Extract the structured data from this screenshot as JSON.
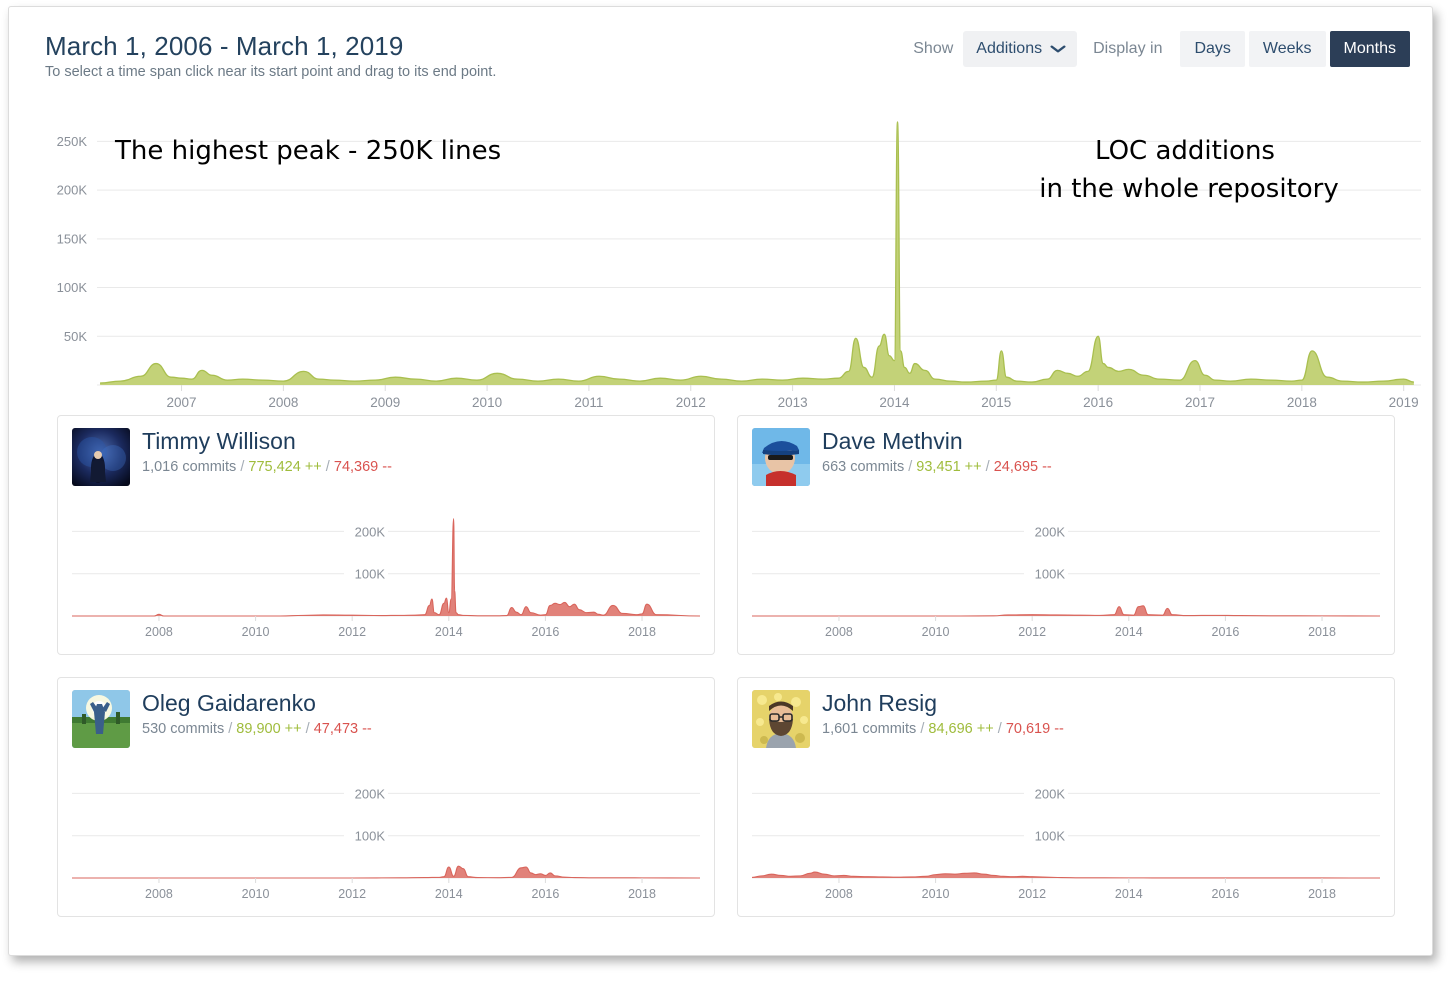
{
  "header": {
    "title": "March 1, 2006 - March 1, 2019",
    "subtitle": "To select a time span click near its start point and drag to its end point.",
    "show_label": "Show",
    "metric_selected": "Additions",
    "metric_options": [
      "Additions"
    ],
    "chevron": "⌄",
    "display_in_label": "Display in",
    "granularity": [
      {
        "label": "Days",
        "active": false
      },
      {
        "label": "Weeks",
        "active": false
      },
      {
        "label": "Months",
        "active": true
      }
    ]
  },
  "annotations": {
    "left": "The highest peak - 250K lines",
    "right_line1": "LOC additions",
    "right_line2": "in the whole repository"
  },
  "colors": {
    "main_fill": "#c3d278",
    "main_stroke": "#a9bf4f",
    "contrib_fill": "#e1827a",
    "contrib_stroke": "#d9655c",
    "accent_dark": "#2c3e57",
    "additions_green": "#9fbc3c",
    "deletions_red": "#d9534f",
    "grid": "#e9e9e9",
    "axis_text": "#8a9099"
  },
  "chart_data": {
    "type": "area",
    "title": "LOC additions in the whole repository",
    "xlabel": "",
    "ylabel": "",
    "ylim": [
      0,
      275000
    ],
    "yticks": [
      50000,
      100000,
      150000,
      200000,
      250000
    ],
    "ytick_labels": [
      "50K",
      "100K",
      "150K",
      "200K",
      "250K"
    ],
    "xticks": [
      2007,
      2008,
      2009,
      2010,
      2011,
      2012,
      2013,
      2014,
      2015,
      2016,
      2017,
      2018,
      2019
    ],
    "xtick_labels": [
      "2007",
      "2008",
      "2009",
      "2010",
      "2011",
      "2012",
      "2013",
      "2014",
      "2015",
      "2016",
      "2017",
      "2018",
      "2019"
    ],
    "xlim": [
      2006.17,
      2019.17
    ],
    "grid": true,
    "legend": "none",
    "series": [
      {
        "name": "Additions (months)",
        "x": [
          2006.2,
          2006.4,
          2006.6,
          2006.75,
          2006.9,
          2007.0,
          2007.1,
          2007.2,
          2007.3,
          2007.45,
          2007.6,
          2007.8,
          2008.0,
          2008.2,
          2008.35,
          2008.5,
          2008.7,
          2008.9,
          2009.1,
          2009.3,
          2009.5,
          2009.7,
          2009.9,
          2010.1,
          2010.3,
          2010.5,
          2010.7,
          2010.9,
          2011.1,
          2011.3,
          2011.5,
          2011.7,
          2011.9,
          2012.1,
          2012.3,
          2012.5,
          2012.7,
          2012.9,
          2013.1,
          2013.3,
          2013.45,
          2013.55,
          2013.62,
          2013.7,
          2013.78,
          2013.85,
          2013.9,
          2013.95,
          2014.0,
          2014.03,
          2014.06,
          2014.1,
          2014.15,
          2014.2,
          2014.3,
          2014.4,
          2014.55,
          2014.7,
          2014.9,
          2015.0,
          2015.05,
          2015.1,
          2015.2,
          2015.35,
          2015.5,
          2015.6,
          2015.7,
          2015.8,
          2015.9,
          2016.0,
          2016.05,
          2016.1,
          2016.2,
          2016.3,
          2016.45,
          2016.6,
          2016.8,
          2016.95,
          2017.05,
          2017.15,
          2017.3,
          2017.5,
          2017.7,
          2017.9,
          2018.0,
          2018.1,
          2018.25,
          2018.4,
          2018.6,
          2018.8,
          2019.0,
          2019.1
        ],
        "y": [
          2000,
          4000,
          9000,
          22000,
          8000,
          7000,
          6000,
          15000,
          10000,
          5000,
          6000,
          5000,
          4000,
          14000,
          6000,
          5000,
          4000,
          5000,
          8000,
          6000,
          4000,
          7000,
          5000,
          12000,
          6000,
          4000,
          6000,
          4000,
          9000,
          6000,
          4000,
          7000,
          5000,
          9000,
          6000,
          4000,
          6000,
          5000,
          7000,
          6000,
          7000,
          14000,
          48000,
          18000,
          8000,
          40000,
          52000,
          30000,
          25000,
          270000,
          35000,
          18000,
          12000,
          22000,
          15000,
          6000,
          4000,
          3000,
          4000,
          5000,
          35000,
          8000,
          4000,
          3000,
          6000,
          15000,
          12000,
          9000,
          14000,
          50000,
          22000,
          18000,
          14000,
          16000,
          10000,
          6000,
          5000,
          25000,
          10000,
          5000,
          4000,
          6000,
          5000,
          4000,
          5000,
          35000,
          8000,
          4000,
          3000,
          4000,
          6000,
          3000
        ]
      }
    ]
  },
  "contributors": [
    {
      "name": "Timmy Willison",
      "commits": "1,016 commits",
      "additions": "775,424 ++",
      "deletions": "74,369 --",
      "avatar": "avatar-timmy",
      "chart": {
        "type": "area",
        "ylim": [
          0,
          260000
        ],
        "yticks": [
          100000,
          200000
        ],
        "ytick_labels": [
          "100K",
          "200K"
        ],
        "xticks": [
          2008,
          2010,
          2012,
          2014,
          2016,
          2018
        ],
        "xtick_labels": [
          "2008",
          "2010",
          "2012",
          "2014",
          "2016",
          "2018"
        ],
        "xlim": [
          2006.2,
          2019.2
        ],
        "x": [
          2006.2,
          2007.5,
          2007.9,
          2008.0,
          2008.1,
          2009.0,
          2010.5,
          2011.0,
          2011.4,
          2012.0,
          2012.6,
          2013.0,
          2013.3,
          2013.5,
          2013.6,
          2013.65,
          2013.7,
          2013.8,
          2013.9,
          2013.95,
          2014.0,
          2014.05,
          2014.1,
          2014.12,
          2014.15,
          2014.2,
          2014.3,
          2014.6,
          2015.0,
          2015.2,
          2015.3,
          2015.4,
          2015.5,
          2015.6,
          2015.7,
          2015.9,
          2016.0,
          2016.1,
          2016.2,
          2016.3,
          2016.4,
          2016.5,
          2016.6,
          2016.7,
          2016.85,
          2017.0,
          2017.1,
          2017.2,
          2017.4,
          2017.6,
          2017.9,
          2018.0,
          2018.1,
          2018.3,
          2019.2
        ],
        "y": [
          0,
          0,
          0,
          4000,
          0,
          0,
          0,
          1500,
          2500,
          2000,
          1000,
          1500,
          2000,
          3000,
          25000,
          40000,
          8000,
          3000,
          30000,
          42000,
          8000,
          40000,
          230000,
          60000,
          8000,
          3000,
          1500,
          500,
          500,
          1000,
          20000,
          9000,
          3000,
          22000,
          8000,
          2000,
          3000,
          25000,
          30000,
          27000,
          32000,
          22000,
          28000,
          15000,
          8000,
          9000,
          4000,
          2000,
          25000,
          6000,
          3000,
          5000,
          28000,
          3000,
          0
        ]
      }
    },
    {
      "name": "Dave Methvin",
      "commits": "663 commits",
      "additions": "93,451 ++",
      "deletions": "24,695 --",
      "avatar": "avatar-dave",
      "chart": {
        "type": "area",
        "ylim": [
          0,
          260000
        ],
        "yticks": [
          100000,
          200000
        ],
        "ytick_labels": [
          "100K",
          "200K"
        ],
        "xticks": [
          2008,
          2010,
          2012,
          2014,
          2016,
          2018
        ],
        "xtick_labels": [
          "2008",
          "2010",
          "2012",
          "2014",
          "2016",
          "2018"
        ],
        "xlim": [
          2006.2,
          2019.2
        ],
        "x": [
          2006.2,
          2009.0,
          2010.5,
          2011.2,
          2011.5,
          2012.0,
          2012.5,
          2013.0,
          2013.4,
          2013.7,
          2013.8,
          2013.9,
          2014.1,
          2014.2,
          2014.3,
          2014.4,
          2014.7,
          2014.8,
          2014.9,
          2015.2,
          2015.8,
          2016.3,
          2017.0,
          2018.0,
          2019.2
        ],
        "y": [
          0,
          0,
          0,
          500,
          2500,
          3000,
          2500,
          2000,
          1500,
          3000,
          22000,
          3000,
          2000,
          22000,
          24000,
          3000,
          2000,
          18000,
          3000,
          1000,
          1500,
          1000,
          500,
          300,
          0
        ]
      }
    },
    {
      "name": "Oleg Gaidarenko",
      "commits": "530 commits",
      "additions": "89,900 ++",
      "deletions": "47,473 --",
      "avatar": "avatar-oleg",
      "chart": {
        "type": "area",
        "ylim": [
          0,
          260000
        ],
        "yticks": [
          100000,
          200000
        ],
        "ytick_labels": [
          "100K",
          "200K"
        ],
        "xticks": [
          2008,
          2010,
          2012,
          2014,
          2016,
          2018
        ],
        "xtick_labels": [
          "2008",
          "2010",
          "2012",
          "2014",
          "2016",
          "2018"
        ],
        "xlim": [
          2006.2,
          2019.2
        ],
        "x": [
          2006.2,
          2012.0,
          2013.0,
          2013.5,
          2013.8,
          2013.9,
          2014.0,
          2014.1,
          2014.2,
          2014.3,
          2014.4,
          2014.6,
          2015.0,
          2015.3,
          2015.5,
          2015.6,
          2015.7,
          2015.8,
          2015.9,
          2016.0,
          2016.1,
          2016.2,
          2016.4,
          2016.6,
          2017.0,
          2018.0,
          2019.2
        ],
        "y": [
          0,
          0,
          500,
          1000,
          1500,
          3000,
          26000,
          4000,
          28000,
          22000,
          3000,
          1000,
          800,
          1500,
          24000,
          26000,
          12000,
          8000,
          10000,
          6000,
          12000,
          5000,
          2000,
          1000,
          500,
          300,
          0
        ]
      }
    },
    {
      "name": "John Resig",
      "commits": "1,601 commits",
      "additions": "84,696 ++",
      "deletions": "70,619 --",
      "avatar": "avatar-john",
      "chart": {
        "type": "area",
        "ylim": [
          0,
          260000
        ],
        "yticks": [
          100000,
          200000
        ],
        "ytick_labels": [
          "100K",
          "200K"
        ],
        "xticks": [
          2008,
          2010,
          2012,
          2014,
          2016,
          2018
        ],
        "xtick_labels": [
          "2008",
          "2010",
          "2012",
          "2014",
          "2016",
          "2018"
        ],
        "xlim": [
          2006.2,
          2019.2
        ],
        "x": [
          2006.2,
          2006.4,
          2006.6,
          2006.8,
          2007.0,
          2007.2,
          2007.4,
          2007.5,
          2007.7,
          2007.9,
          2008.1,
          2008.3,
          2008.6,
          2008.9,
          2009.2,
          2009.5,
          2009.8,
          2010.0,
          2010.2,
          2010.4,
          2010.6,
          2010.8,
          2011.0,
          2011.2,
          2011.4,
          2011.6,
          2011.8,
          2012.0,
          2012.3,
          2012.6,
          2013.0,
          2014.0,
          2015.0,
          2016.0,
          2017.0,
          2018.0,
          2019.2
        ],
        "y": [
          1500,
          5000,
          9000,
          6000,
          4000,
          5000,
          11000,
          14000,
          9000,
          5000,
          6000,
          4000,
          3000,
          2500,
          2000,
          2500,
          4000,
          8000,
          10000,
          9000,
          11000,
          12000,
          9000,
          6000,
          4000,
          3000,
          4000,
          3000,
          2000,
          1000,
          500,
          300,
          200,
          150,
          100,
          50,
          0
        ]
      }
    }
  ]
}
